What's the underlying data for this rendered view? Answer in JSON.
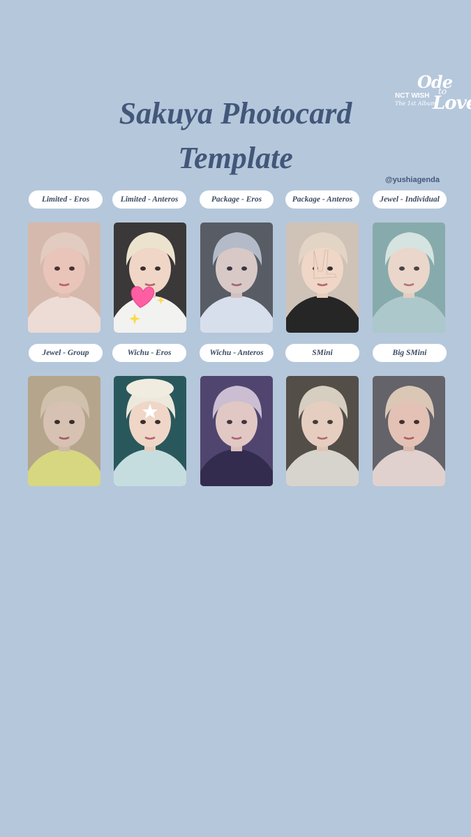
{
  "title": {
    "line1": "Sakuya Photocard",
    "line2": "Template"
  },
  "logo": {
    "brand": "NCT WISH",
    "sub": "The 1st Album",
    "word1": "Ode",
    "word2": "to",
    "word3": "Love"
  },
  "handle": "@yushiagenda",
  "rows": [
    {
      "labels": [
        "Limited - Eros",
        "Limited - Anteros",
        "Package - Eros",
        "Package - Anteros",
        "Jewel - Individual"
      ],
      "cards": [
        {
          "bg": "#d9c9b8",
          "hair": "#e8ddd0",
          "outfit": "#f4efe6",
          "accent": "#c0485a",
          "icon": "face-photo"
        },
        {
          "bg": "#3a3838",
          "hair": "#ece3cf",
          "outfit": "#f2f2f0",
          "accent": "#ff5fa2",
          "icon": "sparkling-heart-icon"
        },
        {
          "bg": "#5e5a58",
          "hair": "#c7c7c9",
          "outfit": "#f0f0f2",
          "accent": "#2e6bc4",
          "icon": "face-photo"
        },
        {
          "bg": "#cfc2b6",
          "hair": "#e2d5c6",
          "outfit": "#262626",
          "accent": "#d9cfc4",
          "icon": "peace-sign"
        },
        {
          "bg": "#7fa6a4",
          "hair": "#d8e6e0",
          "outfit": "#a9c7c8",
          "accent": "#c9d4ea",
          "icon": "face-photo"
        }
      ]
    },
    {
      "labels": [
        "Jewel - Group",
        "Wichu - Eros",
        "Wichu - Anteros",
        "SMini",
        "Big SMini"
      ],
      "cards": [
        {
          "bg": "#c9b79a",
          "hair": "#e6d7bd",
          "outfit": "#eef08c",
          "accent": "#2b2b2b",
          "icon": "face-photo"
        },
        {
          "bg": "#29585c",
          "hair": "#ece8dc",
          "outfit": "#c6dde0",
          "accent": "#ffffff",
          "icon": "star-icon"
        },
        {
          "bg": "#4a4166",
          "hair": "#d6cbd8",
          "outfit": "#2a2540",
          "accent": "#7a64b4",
          "icon": "face-photo"
        },
        {
          "bg": "#4b4540",
          "hair": "#ded6c8",
          "outfit": "#e0ddd6",
          "accent": "#9a9088",
          "icon": "face-photo"
        },
        {
          "bg": "#5e6a70",
          "hair": "#e6dcc8",
          "outfit": "#ece8e4",
          "accent": "#8c2f3a",
          "icon": "face-photo"
        }
      ]
    }
  ]
}
